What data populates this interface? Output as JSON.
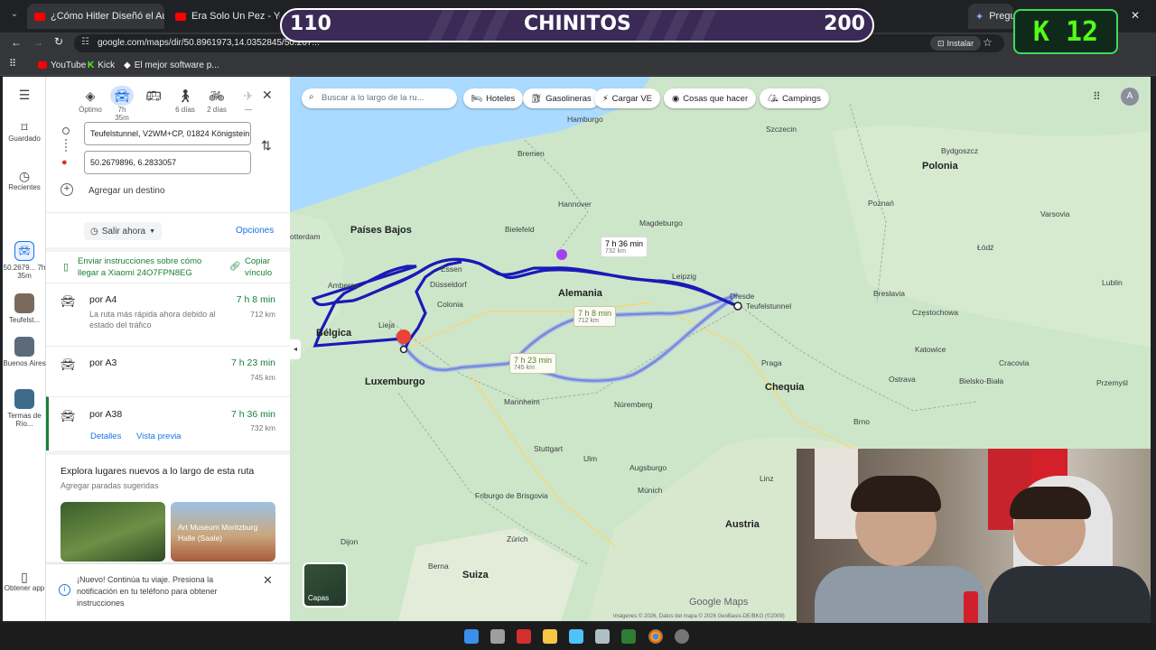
{
  "browser": {
    "tabs": [
      {
        "title": "¿Cómo Hitler Diseñó el Auto Pl"
      },
      {
        "title": "Era Solo Un Pez - YouTube"
      }
    ],
    "right_tab": "Pregunt",
    "url": "google.com/maps/dir/50.8961973,14.0352845/50.267...",
    "install_label": "Instalar",
    "profile_initial": "A",
    "bookmarks": [
      "YouTube",
      "Kick",
      "El mejor software p..."
    ]
  },
  "overlay": {
    "left_score": "110",
    "title": "CHINITOS",
    "right_score": "200"
  },
  "kick_box": {
    "letter": "K",
    "number": "12"
  },
  "rail": {
    "menu_icon": "menu-icon",
    "items": [
      {
        "label": "Guardado",
        "icon": "bookmark-icon"
      },
      {
        "label": "Recientes",
        "icon": "history-icon"
      },
      {
        "label": "50.2679... 7h 35m",
        "icon": "car-icon"
      },
      {
        "label": "Teufelst...",
        "icon": "place-thumb"
      },
      {
        "label": "Buenos Aires",
        "icon": "place-thumb"
      },
      {
        "label": "Termas de Río...",
        "icon": "place-thumb"
      },
      {
        "label": "Obtener app",
        "icon": "phone-icon"
      }
    ]
  },
  "directions": {
    "modes": [
      {
        "name": "optimo",
        "label": "Óptimo",
        "icon": "diamond-icon"
      },
      {
        "name": "car",
        "label": "7h 35m",
        "icon": "car-icon",
        "selected": true
      },
      {
        "name": "transit",
        "label": "",
        "icon": "bus-icon"
      },
      {
        "name": "walk",
        "label": "6 días",
        "icon": "walk-icon"
      },
      {
        "name": "bike",
        "label": "2 días",
        "icon": "bike-icon"
      },
      {
        "name": "flight",
        "label": "—",
        "icon": "plane-icon"
      }
    ],
    "origin": "Teufelstunnel, V2WM+CP, 01824 Königstein",
    "destination": "50.2679896, 6.2833057",
    "add_destination": "Agregar un destino",
    "depart": "Salir ahora",
    "options": "Opciones",
    "send_instructions": "Enviar instrucciones sobre cómo llegar a Xiaomi 24O7FPN8EG",
    "copy_link": "Copiar vínculo",
    "routes": [
      {
        "name": "por A4",
        "time": "7 h 8 min",
        "distance": "712 km",
        "note": "La ruta más rápida ahora debido al estado del tráfico"
      },
      {
        "name": "por A3",
        "time": "7 h 23 min",
        "distance": "745 km",
        "note": ""
      },
      {
        "name": "por A38",
        "time": "7 h 36 min",
        "distance": "732 km",
        "note": ""
      }
    ],
    "details": "Detalles",
    "preview": "Vista previa",
    "explore_title": "Explora lugares nuevos a lo largo de esta ruta",
    "explore_sub": "Agregar paradas sugeridas",
    "card_label": "Art Museum Moritzburg Halle (Saale)",
    "notice": "¡Nuevo! Continúa tu viaje. Presiona la notificación en tu teléfono para obtener instrucciones"
  },
  "map": {
    "search_placeholder": "Buscar a lo largo de la ru...",
    "chips": [
      "Hoteles",
      "Gasolineras",
      "Cargar VE",
      "Cosas que hacer",
      "Campings"
    ],
    "countries": [
      "Polonia",
      "Países Bajos",
      "Alemania",
      "Bélgica",
      "Luxemburgo",
      "Chequia",
      "Austria",
      "Suiza"
    ],
    "cities": [
      "Hamburgo",
      "Szczecin",
      "Bremen",
      "Bydgoszcz",
      "Hannover",
      "Poznań",
      "Magdeburgo",
      "Varsovia",
      "Bielefeld",
      "otterdam",
      "Łódź",
      "Essen",
      "Leipzig",
      "Düsseldorf",
      "Dresde",
      "Teufelstunnel",
      "Amberes",
      "Colonia",
      "Breslavia",
      "Lublin",
      "Lieja",
      "Częstochowa",
      "Katowice",
      "Praga",
      "Cracovia",
      "Ostrava",
      "Bielsko-Biała",
      "Mannheim",
      "Núremberg",
      "Przemyśl",
      "Brno",
      "Stuttgart",
      "Múnich",
      "Friburgo de Brisgovia",
      "Zúrich",
      "Berna",
      "Dijon",
      "Ulm",
      "Augsburgo",
      "Linz"
    ],
    "route_badges": [
      {
        "time": "7 h 36 min",
        "distance": "732 km"
      },
      {
        "time": "7 h 8 min",
        "distance": "712 km"
      },
      {
        "time": "7 h 23 min",
        "distance": "745 km"
      }
    ],
    "layers": "Capas",
    "logo": "Google Maps",
    "attribution": "Imágenes © 2026, Datos del mapa © 2026 GeoBasis-DE/BKG (©2009)"
  },
  "taskbar": {
    "icons": [
      "windows-icon",
      "taskview-icon",
      "app-l-icon",
      "folder-icon",
      "store-icon",
      "calculator-icon",
      "terminal-icon",
      "chrome-icon",
      "settings-icon"
    ]
  }
}
